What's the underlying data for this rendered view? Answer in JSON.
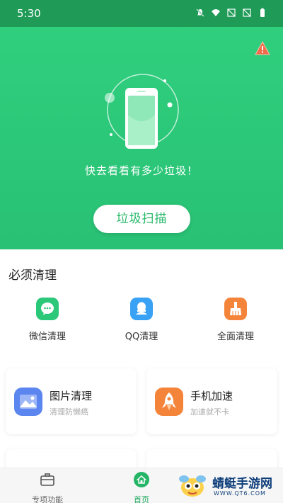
{
  "status_bar": {
    "time": "5:30",
    "icons": [
      "mute-icon",
      "wifi-icon",
      "no-sim-icon",
      "no-sim-icon",
      "battery-icon"
    ]
  },
  "hero": {
    "message": "快去看看有多少垃圾！",
    "scan_button": "垃圾扫描",
    "accent": "#2fcf7e"
  },
  "must_clean": {
    "title": "必须清理",
    "items": [
      {
        "label": "微信清理",
        "icon": "wechat-icon",
        "color": "#2cc879"
      },
      {
        "label": "QQ清理",
        "icon": "qq-icon",
        "color": "#3aa2f4"
      },
      {
        "label": "全面清理",
        "icon": "broom-icon",
        "color": "#f5843b"
      }
    ]
  },
  "cards": [
    {
      "title": "图片清理",
      "subtitle": "清理防懒癌",
      "icon": "image-icon",
      "color": "#5b86f0"
    },
    {
      "title": "手机加速",
      "subtitle": "加速就不卡",
      "icon": "rocket-icon",
      "color": "#f5843b"
    }
  ],
  "tabs": [
    {
      "label": "专项功能",
      "icon": "briefcase-icon",
      "active": false
    },
    {
      "label": "首页",
      "icon": "home-icon",
      "active": true
    }
  ],
  "watermark": {
    "text": "蜻蜓手游网",
    "url": "WWW.QT6.COM"
  }
}
